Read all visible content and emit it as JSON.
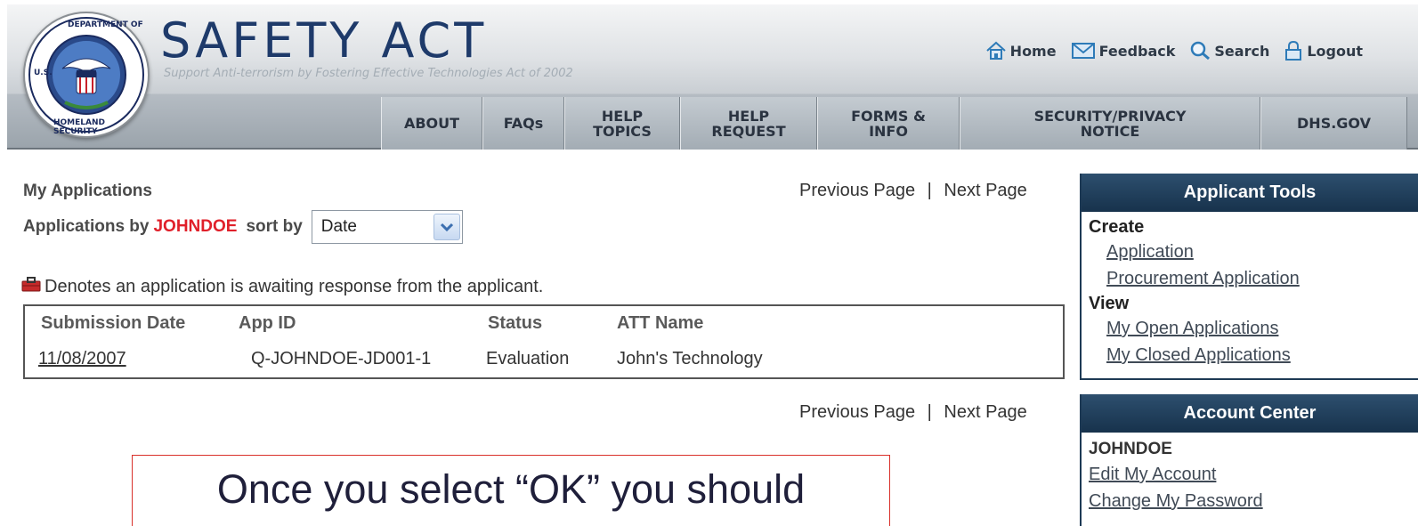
{
  "header": {
    "title": "SAFETY ACT",
    "tagline": "Support Anti-terrorism by Fostering Effective Technologies Act of 2002",
    "seal_text_top": "DEPARTMENT OF",
    "seal_text_left": "U.S.",
    "seal_text_bottom": "HOMELAND SECURITY",
    "util_links": {
      "home": "Home",
      "feedback": "Feedback",
      "search": "Search",
      "logout": "Logout"
    },
    "nav": {
      "about": "ABOUT",
      "faqs": "FAQs",
      "help_topics_1": "HELP",
      "help_topics_2": "TOPICS",
      "help_request_1": "HELP",
      "help_request_2": "REQUEST",
      "forms_1": "FORMS &",
      "forms_2": "INFO",
      "security_1": "SECURITY/PRIVACY",
      "security_2": "NOTICE",
      "dhs": "DHS.GOV"
    }
  },
  "main": {
    "heading": "My Applications",
    "pager": {
      "prev": "Previous Page",
      "sep": "|",
      "next": "Next Page"
    },
    "sort_prefix": "Applications by",
    "user": "JOHNDOE",
    "sort_by_label": "sort by",
    "sort_value": "Date",
    "legend_text": "Denotes an application is awaiting response from the applicant.",
    "table": {
      "headers": [
        "Submission Date",
        "App ID",
        "Status",
        "ATT Name"
      ],
      "rows": [
        [
          "11/08/2007",
          "Q-JOHNDOE-JD001-1",
          "Evaluation",
          "John's Technology"
        ]
      ]
    },
    "notice": "Once you select “OK” you should"
  },
  "sidebar": {
    "tools": {
      "title": "Applicant Tools",
      "create_label": "Create",
      "create_links": [
        "Application",
        "Procurement Application"
      ],
      "view_label": "View",
      "view_links": [
        "My Open Applications",
        "My Closed Applications"
      ]
    },
    "account": {
      "title": "Account Center",
      "user": "JOHNDOE",
      "links": [
        "Edit My Account",
        "Change My Password"
      ]
    }
  },
  "colors": {
    "brand_navy": "#1e3a6a",
    "panel_header": "#1e3a55",
    "user_highlight": "#e0202a",
    "notice_border": "#d9302a"
  }
}
